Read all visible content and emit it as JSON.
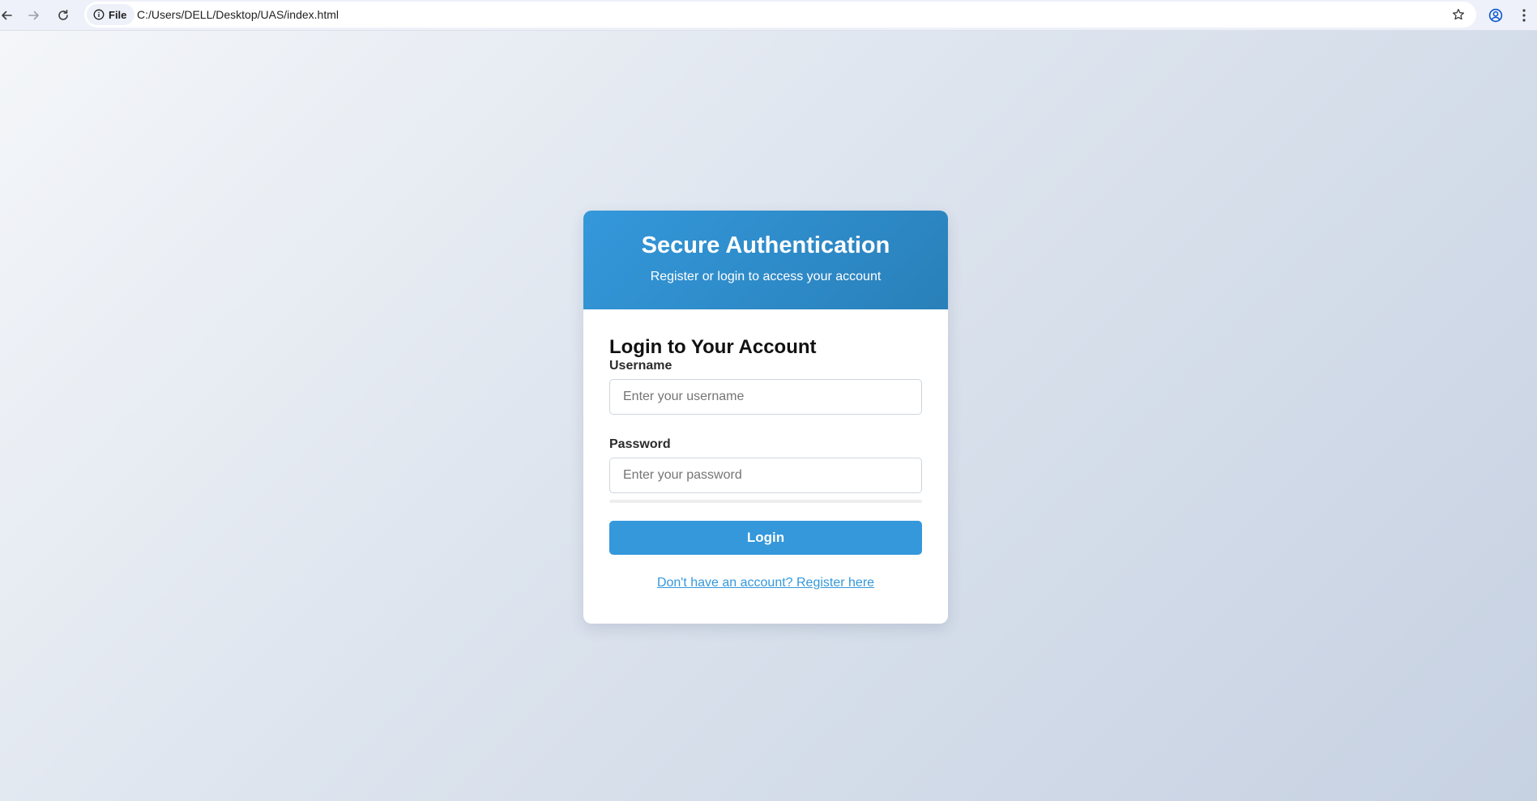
{
  "browser": {
    "site_chip_label": "File",
    "url": "C:/Users/DELL/Desktop/UAS/index.html",
    "icons": {
      "back": "back-arrow-icon",
      "forward": "forward-arrow-icon",
      "reload": "reload-icon",
      "info": "info-icon",
      "bookmark": "star-icon",
      "profile": "profile-icon",
      "menu": "kebab-menu-icon"
    }
  },
  "header": {
    "title": "Secure Authentication",
    "subtitle": "Register or login to access your account"
  },
  "login_form": {
    "title": "Login to Your Account",
    "username_label": "Username",
    "username_value": "",
    "username_placeholder": "Enter your username",
    "password_label": "Password",
    "password_value": "",
    "password_placeholder": "Enter your password",
    "submit_label": "Login",
    "switch_link": "Don't have an account? Register here"
  },
  "colors": {
    "accent": "#3498db",
    "header_gradient_start": "#3498db",
    "header_gradient_end": "#2980b9",
    "background_start": "#f4f6f9",
    "background_end": "#c6d1e2"
  }
}
